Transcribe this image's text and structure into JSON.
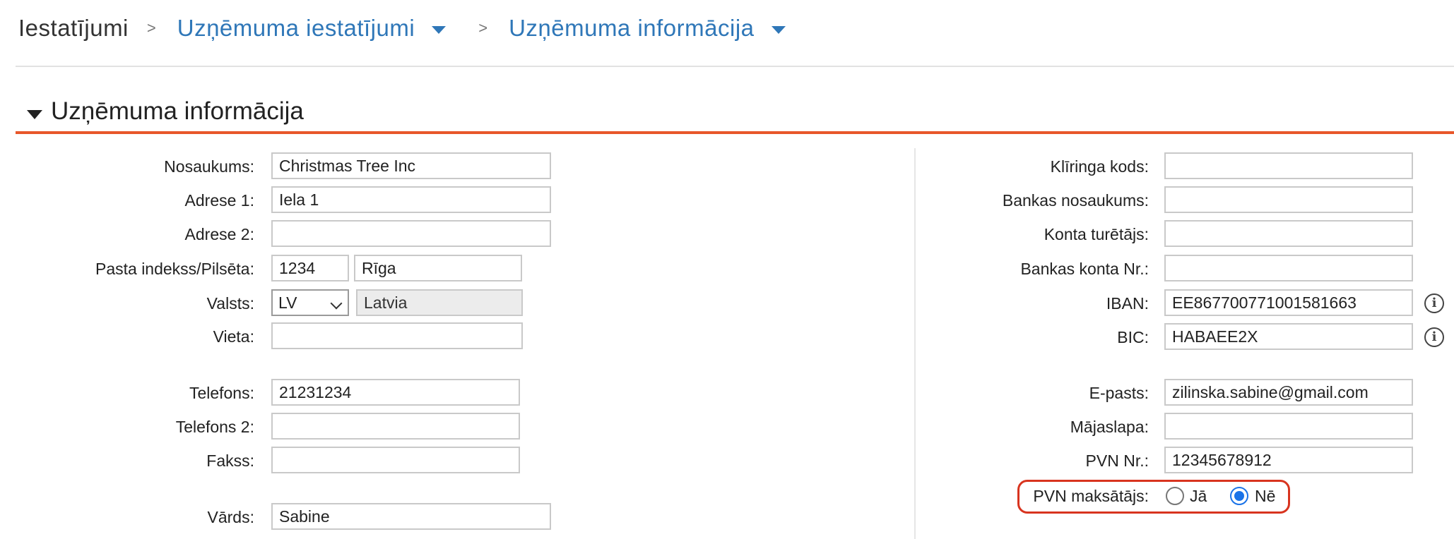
{
  "breadcrumb": {
    "root": "Iestatījumi",
    "separator": ">",
    "level1": "Uzņēmuma iestatījumi",
    "level2": "Uzņēmuma informācija"
  },
  "section": {
    "title": "Uzņēmuma informācija"
  },
  "left": {
    "name_label": "Nosaukums:",
    "name_value": "Christmas Tree Inc",
    "address1_label": "Adrese 1:",
    "address1_value": "Iela 1",
    "address2_label": "Adrese 2:",
    "address2_value": "",
    "postal_city_label": "Pasta indekss/Pilsēta:",
    "postal_value": "1234",
    "city_value": "Rīga",
    "country_label": "Valsts:",
    "country_code": "LV",
    "country_name": "Latvia",
    "location_label": "Vieta:",
    "location_value": "",
    "phone_label": "Telefons:",
    "phone_value": "21231234",
    "phone2_label": "Telefons 2:",
    "phone2_value": "",
    "fax_label": "Fakss:",
    "fax_value": "",
    "firstname_label": "Vārds:",
    "firstname_value": "Sabine"
  },
  "right": {
    "clearing_label": "Klīringa kods:",
    "clearing_value": "",
    "bankname_label": "Bankas nosaukums:",
    "bankname_value": "",
    "holder_label": "Konta turētājs:",
    "holder_value": "",
    "account_label": "Bankas konta Nr.:",
    "account_value": "",
    "iban_label": "IBAN:",
    "iban_value": "EE867700771001581663",
    "bic_label": "BIC:",
    "bic_value": "HABAEE2X",
    "email_label": "E-pasts:",
    "email_value": "zilinska.sabine@gmail.com",
    "homepage_label": "Mājaslapa:",
    "homepage_value": "",
    "vatnr_label": "PVN Nr.:",
    "vatnr_value": "12345678912",
    "vatpayer_label": "PVN maksātājs:",
    "vat_yes": "Jā",
    "vat_no": "Nē",
    "vat_selected": "Nē"
  },
  "colors": {
    "accent": "#e8572a",
    "link": "#2f77b8",
    "highlight": "#d8341f",
    "radio": "#1a73e8"
  }
}
